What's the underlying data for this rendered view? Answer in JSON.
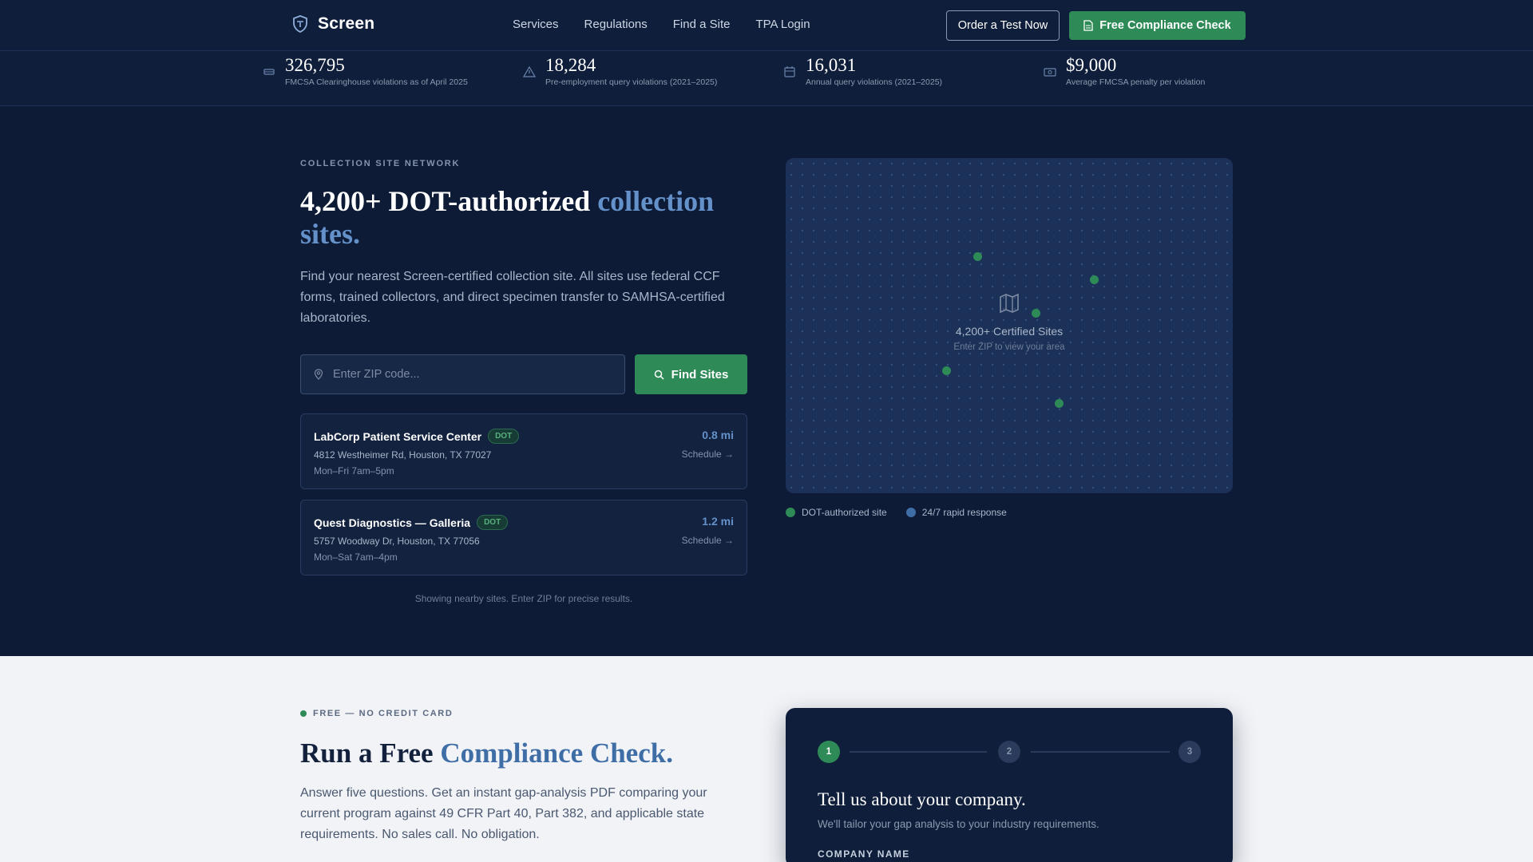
{
  "nav": {
    "brand": "Screen",
    "links": [
      "Services",
      "Regulations",
      "Find a Site",
      "TPA Login"
    ],
    "order_button": "Order a Test Now",
    "compliance_button": "Free Compliance Check"
  },
  "stats": [
    {
      "value": "326,795",
      "label": "FMCSA Clearinghouse violations as of April 2025",
      "icon": "truck-icon"
    },
    {
      "value": "18,284",
      "label": "Pre-employment query violations (2021–2025)",
      "icon": "warning-icon"
    },
    {
      "value": "16,031",
      "label": "Annual query violations (2021–2025)",
      "icon": "calendar-icon"
    },
    {
      "value": "$9,000",
      "label": "Average FMCSA penalty per violation",
      "icon": "money-icon"
    }
  ],
  "hero": {
    "eyebrow": "COLLECTION SITE NETWORK",
    "title_main": "4,200+ DOT-authorized ",
    "title_accent": "collection sites.",
    "description": "Find your nearest Screen-certified collection site. All sites use federal CCF forms, trained collectors, and direct specimen transfer to SAMHSA-certified laboratories.",
    "zip_placeholder": "Enter ZIP code...",
    "find_button": "Find Sites"
  },
  "sites": [
    {
      "name": "LabCorp Patient Service Center",
      "badge": "DOT",
      "address": "4812 Westheimer Rd, Houston, TX 77027",
      "hours": "Mon–Fri 7am–5pm",
      "distance": "0.8 mi",
      "schedule": "Schedule →"
    },
    {
      "name": "Quest Diagnostics — Galleria",
      "badge": "DOT",
      "address": "5757 Woodway Dr, Houston, TX 77056",
      "hours": "Mon–Sat 7am–4pm",
      "distance": "1.2 mi",
      "schedule": "Schedule →"
    }
  ],
  "showing_text": "Showing nearby sites. Enter ZIP for precise results.",
  "map": {
    "title": "4,200+ Certified Sites",
    "subtitle": "Enter ZIP to view your area",
    "legend": [
      {
        "label": "DOT-authorized site",
        "color": "#2e8b57"
      },
      {
        "label": "24/7 rapid response",
        "color": "#3f6ea6"
      }
    ]
  },
  "compliance": {
    "tag": "FREE — NO CREDIT CARD",
    "title_main": "Run a Free ",
    "title_accent": "Compliance Check.",
    "description": "Answer five questions. Get an instant gap-analysis PDF comparing your current program against 49 CFR Part 40, Part 382, and applicable state requirements. No sales call. No obligation.",
    "steps": [
      "1",
      "2",
      "3"
    ],
    "form_title": "Tell us about your company.",
    "form_subtitle": "We'll tailor your gap analysis to your industry requirements.",
    "field_label": "COMPANY NAME"
  },
  "colors": {
    "accent_green": "#2e8b57",
    "accent_blue": "#6491c9",
    "navy": "#0d1b36"
  }
}
